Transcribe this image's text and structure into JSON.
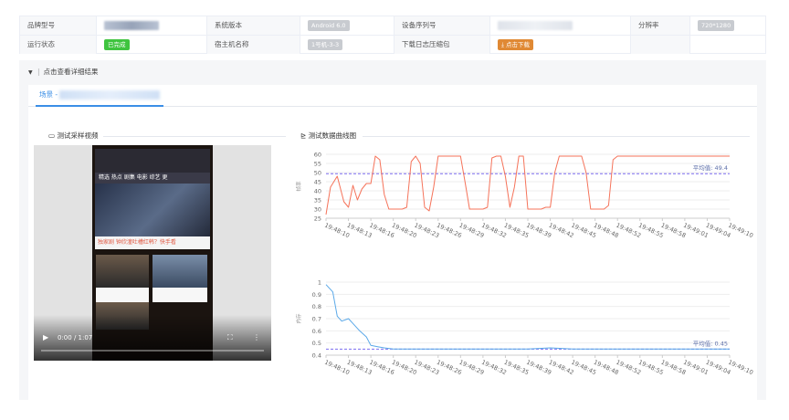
{
  "info": {
    "brand_label": "品牌型号",
    "os_label": "系统版本",
    "os_value": "Android 6.0",
    "serial_label": "设备序列号",
    "resolution_label": "分辨率",
    "resolution_value": "720*1280",
    "status_label": "运行状态",
    "status_value": "已完成",
    "host_label": "宿主机名称",
    "host_value": "1号机-3-3",
    "log_label": "下载日志压缩包",
    "download_button": "⤓ 点击下载"
  },
  "details": {
    "toggle_label": "点击查看详细结果",
    "tab_label": "场景 - "
  },
  "video_section": {
    "title": "测试采样视频",
    "time_display": "0:00 / 1:07",
    "app": {
      "nav_text": "精选  热点  剧集  电影  综艺  更",
      "strip_text": "独家剧  钟欣潼吐槽红韩？快手看"
    }
  },
  "chart_section": {
    "title": "测试数据曲线图"
  },
  "colors": {
    "fps_line": "#f5735a",
    "mem_line": "#5aa8e8",
    "avg_line": "#7c6df0",
    "avg_text": "#5b6da8",
    "accent": "#3a8ee6"
  },
  "chart_data": [
    {
      "type": "line",
      "ylabel": "帧率",
      "ylim": [
        25,
        60
      ],
      "yticks": [
        25,
        30,
        35,
        40,
        45,
        50,
        55,
        60
      ],
      "x_ticks": [
        "19:48:10",
        "19:48:13",
        "19:48:16",
        "19:48:20",
        "19:48:23",
        "19:48:26",
        "19:48:29",
        "19:48:32",
        "19:48:35",
        "19:48:39",
        "19:48:42",
        "19:48:45",
        "19:48:48",
        "19:48:52",
        "19:48:55",
        "19:48:58",
        "19:49:01",
        "19:49:04",
        "19:49:10"
      ],
      "average_label": "平均值: 49.4",
      "average": 49.4,
      "series": [
        {
          "x": [
            0,
            0.2,
            0.5,
            0.8,
            1.0,
            1.2,
            1.4,
            1.6,
            1.8,
            2.0,
            2.2,
            2.4,
            2.6,
            2.8,
            3.0,
            3.2,
            3.4,
            3.6,
            3.8,
            4.0,
            4.2,
            4.4,
            4.6,
            4.8,
            5.0,
            5.2,
            5.4,
            5.6,
            5.8,
            6.0,
            6.2,
            6.4,
            6.6,
            6.8,
            7.0,
            7.2,
            7.4,
            7.6,
            7.8,
            8.0,
            8.2,
            8.4,
            8.6,
            8.8,
            9.0,
            9.2,
            9.4,
            9.6,
            9.8,
            10.0,
            10.2,
            10.4,
            10.6,
            10.8,
            11.0,
            11.2,
            11.4,
            11.6,
            11.8,
            12.0,
            12.2,
            12.4,
            12.6,
            12.8,
            13.0,
            13.2,
            13.4,
            13.6,
            13.8,
            14.0,
            14.2,
            14.4,
            14.6,
            14.8,
            15.0,
            15.2,
            15.4,
            15.6,
            15.8,
            16.0,
            16.2,
            16.4,
            16.6,
            16.8,
            17.0,
            17.2,
            17.4,
            17.6,
            17.8,
            18.0
          ],
          "values": [
            27,
            42,
            48,
            34,
            31,
            43,
            35,
            41,
            44,
            44,
            59,
            57,
            38,
            30,
            30,
            30,
            30,
            31,
            56,
            59,
            55,
            31,
            29,
            42,
            59,
            59,
            59,
            59,
            59,
            59,
            45,
            30,
            30,
            30,
            30,
            31,
            58,
            59,
            59,
            48,
            31,
            42,
            59,
            59,
            30,
            30,
            30,
            30,
            31,
            31,
            50,
            59,
            59,
            59,
            59,
            59,
            59,
            50,
            30,
            30,
            30,
            30,
            32,
            57,
            59,
            59,
            59,
            59,
            59,
            59,
            59,
            59,
            59,
            59,
            59,
            59,
            59,
            59,
            59,
            59,
            59,
            59,
            59,
            59,
            59,
            59,
            59,
            59,
            59,
            59
          ]
        }
      ]
    },
    {
      "type": "line",
      "ylabel": "内存",
      "ylim": [
        0.4,
        1
      ],
      "yticks": [
        0.4,
        0.5,
        0.6,
        0.7,
        0.8,
        0.9,
        1
      ],
      "x_ticks": [
        "19:48:10",
        "19:48:13",
        "19:48:16",
        "19:48:20",
        "19:48:23",
        "19:48:26",
        "19:48:29",
        "19:48:32",
        "19:48:35",
        "19:48:39",
        "19:48:42",
        "19:48:45",
        "19:48:48",
        "19:48:52",
        "19:48:55",
        "19:48:58",
        "19:49:01",
        "19:49:04",
        "19:49:10"
      ],
      "average_label": "平均值: 0.45",
      "average": 0.45,
      "series": [
        {
          "x": [
            0,
            0.3,
            0.5,
            0.7,
            1.0,
            1.2,
            1.5,
            1.8,
            2.0,
            2.3,
            2.6,
            3.0,
            3.5,
            4.0,
            5.0,
            6.0,
            7.0,
            8.0,
            9.0,
            10.0,
            11.0,
            12.0,
            13.0,
            14.0,
            15.0,
            16.0,
            17.0,
            18.0
          ],
          "values": [
            0.98,
            0.92,
            0.72,
            0.68,
            0.7,
            0.66,
            0.6,
            0.55,
            0.48,
            0.47,
            0.46,
            0.45,
            0.45,
            0.45,
            0.45,
            0.45,
            0.45,
            0.45,
            0.45,
            0.46,
            0.45,
            0.45,
            0.45,
            0.45,
            0.45,
            0.45,
            0.45,
            0.45
          ]
        }
      ]
    }
  ]
}
